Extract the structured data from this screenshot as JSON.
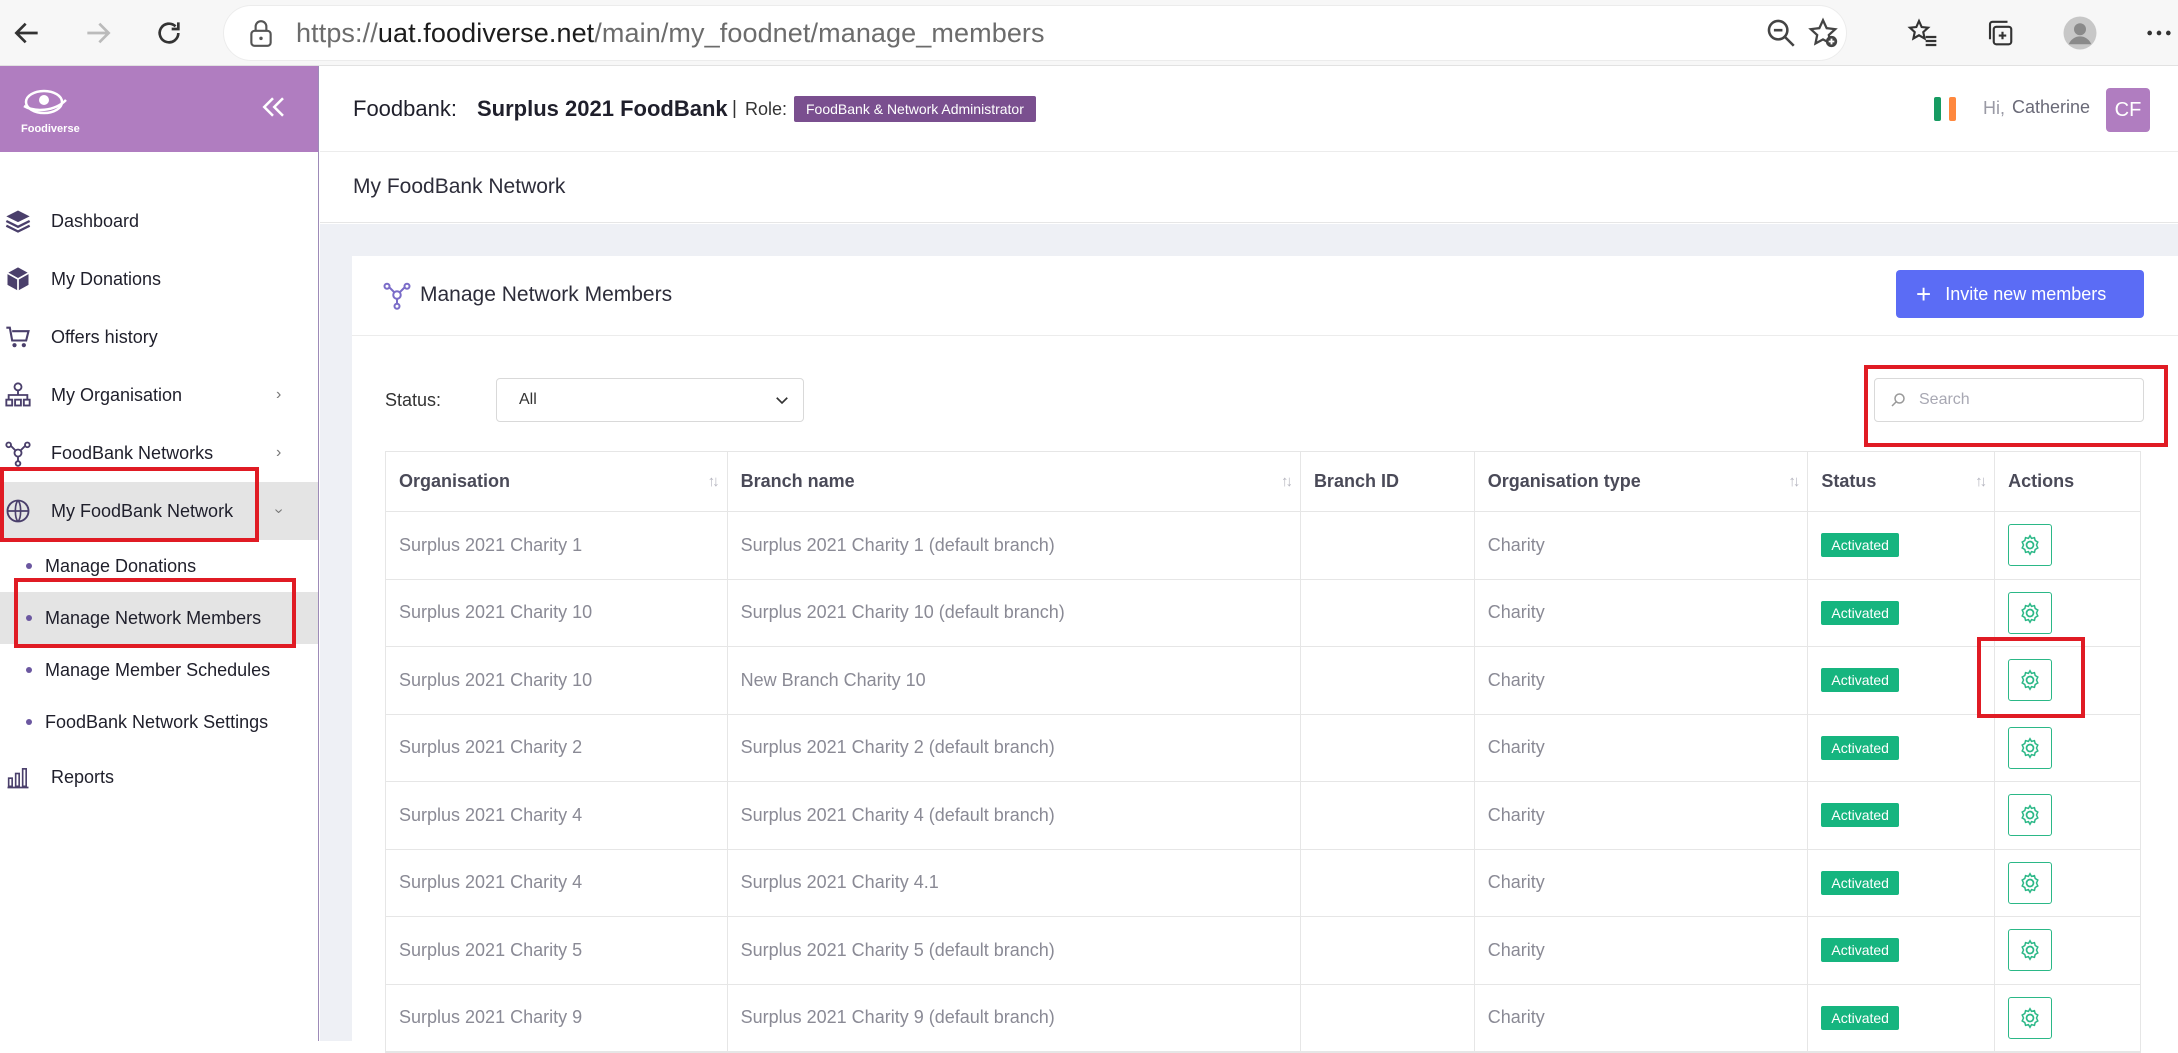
{
  "browser": {
    "url_prefix": "https://",
    "url_domain": "uat.foodiverse.net",
    "url_path": "/main/my_foodnet/manage_members"
  },
  "header": {
    "foodbank_label": "Foodbank:",
    "foodbank_name": "Surplus 2021 FoodBank",
    "separator": "|",
    "role_label": "Role:",
    "role_value": "FoodBank & Network Administrator",
    "greeting": "Hi,",
    "user_name": "Catherine",
    "avatar_initials": "CF"
  },
  "sidebar": {
    "logo_text": "Foodiverse",
    "items": [
      {
        "label": "Dashboard",
        "icon": "layers-icon"
      },
      {
        "label": "My Donations",
        "icon": "box-icon"
      },
      {
        "label": "Offers history",
        "icon": "cart-icon"
      },
      {
        "label": "My Organisation",
        "icon": "org-chart-icon"
      },
      {
        "label": "FoodBank Networks",
        "icon": "network-icon"
      },
      {
        "label": "My FoodBank Network",
        "icon": "globe-icon"
      }
    ],
    "sub_items": [
      {
        "label": "Manage Donations"
      },
      {
        "label": "Manage Network Members"
      },
      {
        "label": "Manage Member Schedules"
      },
      {
        "label": "FoodBank Network Settings"
      }
    ],
    "reports": {
      "label": "Reports",
      "icon": "bar-chart-icon"
    }
  },
  "page": {
    "subheader_title": "My FoodBank Network",
    "card_title": "Manage Network Members",
    "invite_button": "Invite new members",
    "status_label": "Status:",
    "status_value": "All",
    "search_placeholder": "Search"
  },
  "table": {
    "columns": [
      "Organisation",
      "Branch name",
      "Branch ID",
      "Organisation type",
      "Status",
      "Actions"
    ],
    "rows": [
      {
        "organisation": "Surplus 2021 Charity 1",
        "branch": "Surplus 2021 Charity 1 (default branch)",
        "branch_id": "",
        "type": "Charity",
        "status": "Activated"
      },
      {
        "organisation": "Surplus 2021 Charity 10",
        "branch": "Surplus 2021 Charity 10 (default branch)",
        "branch_id": "",
        "type": "Charity",
        "status": "Activated"
      },
      {
        "organisation": "Surplus 2021 Charity 10",
        "branch": "New Branch Charity 10",
        "branch_id": "",
        "type": "Charity",
        "status": "Activated"
      },
      {
        "organisation": "Surplus 2021 Charity 2",
        "branch": "Surplus 2021 Charity 2 (default branch)",
        "branch_id": "",
        "type": "Charity",
        "status": "Activated"
      },
      {
        "organisation": "Surplus 2021 Charity 4",
        "branch": "Surplus 2021 Charity 4 (default branch)",
        "branch_id": "",
        "type": "Charity",
        "status": "Activated"
      },
      {
        "organisation": "Surplus 2021 Charity 4",
        "branch": "Surplus 2021 Charity 4.1",
        "branch_id": "",
        "type": "Charity",
        "status": "Activated"
      },
      {
        "organisation": "Surplus 2021 Charity 5",
        "branch": "Surplus 2021 Charity 5 (default branch)",
        "branch_id": "",
        "type": "Charity",
        "status": "Activated"
      },
      {
        "organisation": "Surplus 2021 Charity 9",
        "branch": "Surplus 2021 Charity 9 (default branch)",
        "branch_id": "",
        "type": "Charity",
        "status": "Activated"
      }
    ]
  },
  "colors": {
    "brand_purple": "#b07dc0",
    "role_badge": "#7a4f8f",
    "primary_button": "#5b6cf5",
    "status_green": "#16b57f",
    "highlight_red": "#e01b24"
  }
}
